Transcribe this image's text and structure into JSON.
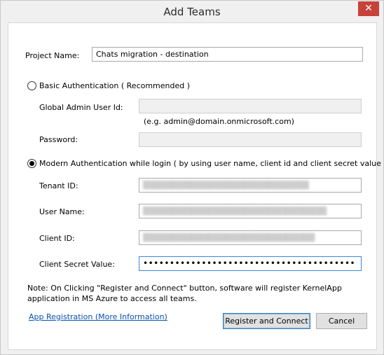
{
  "window": {
    "title": "Add Teams",
    "close_glyph": "✕"
  },
  "project": {
    "label": "Project Name:",
    "value": "Chats migration - destination"
  },
  "basic_auth": {
    "label": "Basic Authentication ( Recommended )",
    "selected": false,
    "admin_label": "Global Admin User Id:",
    "admin_value": "",
    "admin_hint": "(e.g. admin@domain.onmicrosoft.com)",
    "password_label": "Password:",
    "password_value": ""
  },
  "modern_auth": {
    "label": "Modern Authentication while login ( by using user name, client id and client secret value )",
    "selected": true,
    "tenant_label": "Tenant ID:",
    "tenant_value": "▒▒▒▒▒▒▒▒▒▒▒▒▒▒▒▒▒▒▒▒▒▒▒▒▒▒▒▒",
    "username_label": "User Name:",
    "username_value": "▒▒▒▒▒▒▒▒▒▒▒▒▒▒▒▒▒▒▒▒▒▒▒▒▒▒▒▒▒▒▒",
    "clientid_label": "Client ID:",
    "clientid_value": "▒▒▒▒▒▒▒▒▒▒▒▒▒▒▒▒▒▒▒▒▒▒▒▒▒▒▒▒▒",
    "secret_label": "Client Secret Value:",
    "secret_value": "••••••••••••••••••••••••••••••••••••••••"
  },
  "note": {
    "line1": "Note: On Clicking \"Register and Connect\" button, software will register KernelApp",
    "line2": "application in MS Azure to access all teams."
  },
  "footer": {
    "link": "App Registration (More Information)",
    "register_button": "Register and Connect",
    "cancel_button": "Cancel"
  }
}
